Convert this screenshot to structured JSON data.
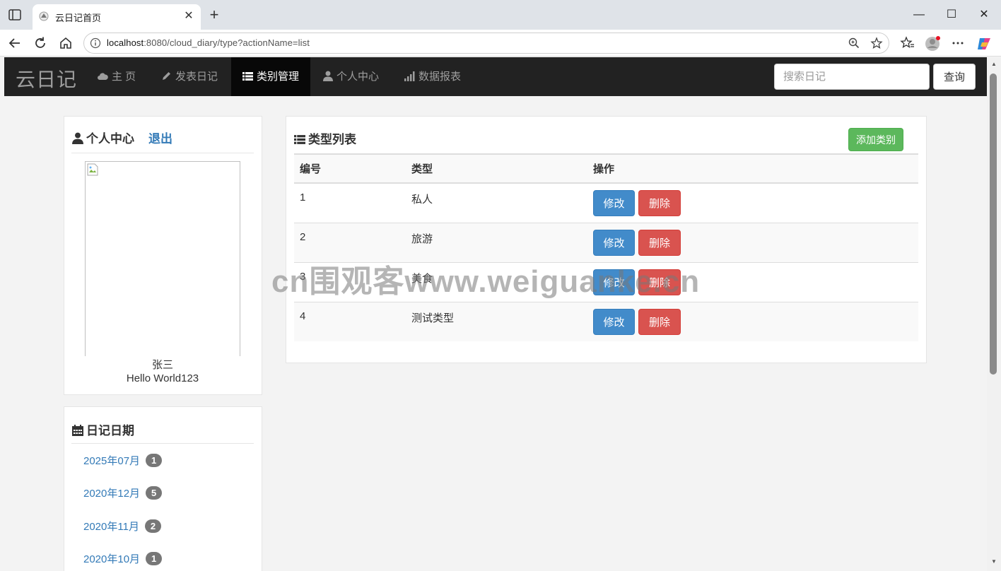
{
  "browser": {
    "tab_title": "云日记首页",
    "tab_close": "✕",
    "new_tab": "+",
    "url_host": "localhost",
    "url_rest": ":8080/cloud_diary/type?actionName=list",
    "minimize": "—",
    "maximize": "☐",
    "close": "✕"
  },
  "navbar": {
    "brand": "云日记",
    "items": [
      {
        "label": "主 页",
        "icon": "cloud-icon"
      },
      {
        "label": "发表日记",
        "icon": "pencil-icon"
      },
      {
        "label": "类别管理",
        "icon": "list-icon"
      },
      {
        "label": "个人中心",
        "icon": "user-icon"
      },
      {
        "label": "数据报表",
        "icon": "signal-icon"
      }
    ],
    "search_placeholder": "搜索日记",
    "search_button": "查询"
  },
  "profile": {
    "heading": "个人中心",
    "logout": "退出",
    "name": "张三",
    "signature": "Hello World123"
  },
  "dates": {
    "heading": "日记日期",
    "items": [
      {
        "label": "2025年07月",
        "count": "1"
      },
      {
        "label": "2020年12月",
        "count": "5"
      },
      {
        "label": "2020年11月",
        "count": "2"
      },
      {
        "label": "2020年10月",
        "count": "1"
      }
    ]
  },
  "types": {
    "heading": "类型列表",
    "add_button": "添加类别",
    "columns": [
      "编号",
      "类型",
      "操作"
    ],
    "edit_label": "修改",
    "delete_label": "删除",
    "rows": [
      {
        "id": "1",
        "name": "私人"
      },
      {
        "id": "2",
        "name": "旅游"
      },
      {
        "id": "3",
        "name": "美食"
      },
      {
        "id": "4",
        "name": "测试类型"
      }
    ]
  },
  "watermark": "cn围观客www.weiguanke.cn",
  "colors": {
    "navbar_bg": "#222222",
    "navbar_active": "#080808",
    "link": "#337ab7",
    "edit_btn": "#428bca",
    "delete_btn": "#d9534f",
    "add_btn": "#5cb85c",
    "badge": "#777777"
  }
}
